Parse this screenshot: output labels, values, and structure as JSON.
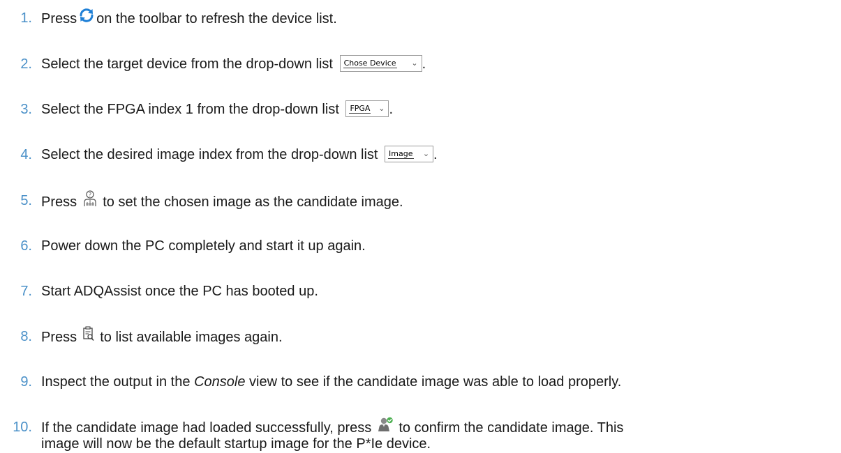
{
  "steps": [
    {
      "number": "1.",
      "before": "Press",
      "icon": "refresh-icon",
      "after": "on the toolbar to refresh the device list."
    },
    {
      "number": "2.",
      "before": "Select the target device from the drop-down list",
      "combo": "Chose Device",
      "after": "."
    },
    {
      "number": "3.",
      "before": "Select the FPGA index 1 from the drop-down list",
      "combo": "FPGA",
      "after": "."
    },
    {
      "number": "4.",
      "before": "Select the desired image index from the drop-down list",
      "combo": "Image",
      "after": "."
    },
    {
      "number": "5.",
      "before": "Press",
      "icon": "set-candidate-image-icon",
      "after": "to set the chosen image as the candidate image."
    },
    {
      "number": "6.",
      "text": "Power down the PC completely and start it up again."
    },
    {
      "number": "7.",
      "text": "Start ADQAssist once the PC has booted up."
    },
    {
      "number": "8.",
      "before": "Press",
      "icon": "list-images-icon",
      "after": "to list available images again."
    },
    {
      "number": "9.",
      "before": "Inspect the output in the",
      "emphasis": "Console",
      "after": "view to see if the candidate image was able to load properly."
    },
    {
      "number": "10.",
      "before": "If the candidate image had loaded successfully, press",
      "icon": "confirm-candidate-image-icon",
      "after": "to confirm the candidate image.  This",
      "continuation": "image will now be the default startup image for the P*Ie device."
    }
  ],
  "colors": {
    "number": "#4a90c8",
    "text": "#1a1a1a",
    "refresh_icon": "#1e7fd6",
    "confirm_check": "#4caf50"
  }
}
